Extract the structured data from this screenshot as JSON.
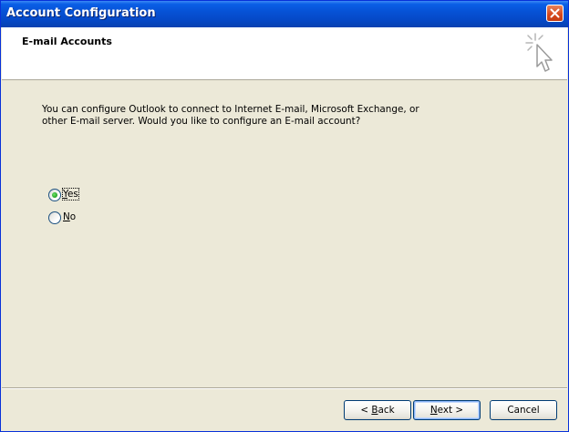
{
  "window": {
    "title": "Account Configuration"
  },
  "header": {
    "title": "E-mail Accounts",
    "icon": "wizard-cursor-icon"
  },
  "body": {
    "description_line1": "You can configure Outlook to connect to Internet E-mail, Microsoft Exchange, or",
    "description_line2": "other E-mail server. Would you like to configure an E-mail account?"
  },
  "options": [
    {
      "mnemonic": "Y",
      "rest": "es",
      "checked": true
    },
    {
      "mnemonic": "N",
      "rest": "o",
      "checked": false
    }
  ],
  "buttons": {
    "back_prefix": "< ",
    "back_mnemonic": "B",
    "back_rest": "ack",
    "next_mnemonic": "N",
    "next_rest": "ext >",
    "cancel": "Cancel"
  },
  "colors": {
    "titlebar": "#0652d6",
    "dialog_bg": "#ece9d8",
    "header_bg": "#ffffff"
  }
}
